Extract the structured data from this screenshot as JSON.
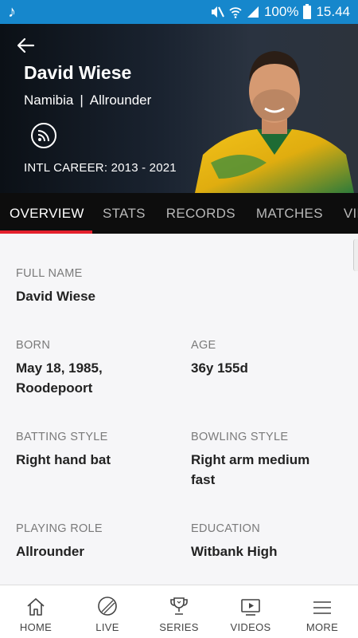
{
  "status_bar": {
    "battery": "100%",
    "time": "15.44"
  },
  "header": {
    "name": "David Wiese",
    "country": "Namibia",
    "separator": "|",
    "role": "Allrounder",
    "career": "INTL CAREER: 2013 - 2021"
  },
  "tabs": [
    {
      "label": "OVERVIEW",
      "active": true
    },
    {
      "label": "STATS"
    },
    {
      "label": "RECORDS"
    },
    {
      "label": "MATCHES"
    },
    {
      "label": "VID"
    }
  ],
  "overview": {
    "full_name": {
      "label": "FULL NAME",
      "value": "David Wiese"
    },
    "born": {
      "label": "BORN",
      "value_line1": "May 18, 1985,",
      "value_line2": "Roodepoort"
    },
    "age": {
      "label": "AGE",
      "value": "36y 155d"
    },
    "batting_style": {
      "label": "BATTING STYLE",
      "value": "Right hand bat"
    },
    "bowling_style": {
      "label": "BOWLING STYLE",
      "value_line1": "Right arm medium",
      "value_line2": "fast"
    },
    "playing_role": {
      "label": "PLAYING ROLE",
      "value": "Allrounder"
    },
    "education": {
      "label": "EDUCATION",
      "value": "Witbank High"
    }
  },
  "bottom_nav": [
    {
      "label": "HOME",
      "icon": "home-icon"
    },
    {
      "label": "LIVE",
      "icon": "cricket-ball-icon"
    },
    {
      "label": "SERIES",
      "icon": "trophy-icon"
    },
    {
      "label": "VIDEOS",
      "icon": "video-icon"
    },
    {
      "label": "MORE",
      "icon": "menu-icon"
    }
  ]
}
